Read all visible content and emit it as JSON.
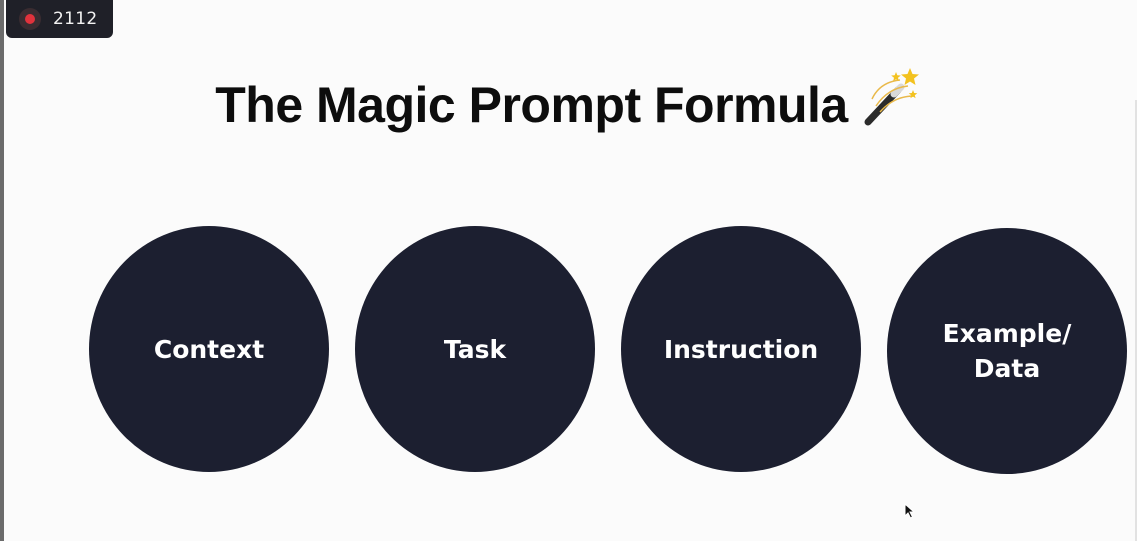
{
  "recording": {
    "count": "2112",
    "indicator_color": "#e0323c"
  },
  "slide": {
    "title": "The Magic Prompt Formula",
    "title_icon": "magic-wand-icon",
    "circles": [
      {
        "label": "Context"
      },
      {
        "label": "Task"
      },
      {
        "label": "Instruction"
      },
      {
        "label": "Example/\nData"
      }
    ],
    "circle_color": "#1c1f30"
  },
  "cursor": {
    "icon": "mouse-pointer-icon"
  }
}
